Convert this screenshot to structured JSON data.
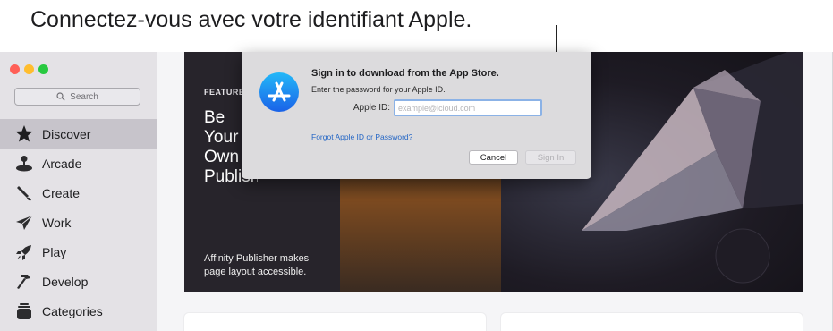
{
  "caption": "Connectez-vous avec votre identifiant Apple.",
  "sidebar": {
    "search_placeholder": "Search",
    "items": [
      {
        "label": "Discover",
        "icon": "star-icon",
        "active": true
      },
      {
        "label": "Arcade",
        "icon": "joystick-icon",
        "active": false
      },
      {
        "label": "Create",
        "icon": "brush-icon",
        "active": false
      },
      {
        "label": "Work",
        "icon": "paper-plane-icon",
        "active": false
      },
      {
        "label": "Play",
        "icon": "rocket-icon",
        "active": false
      },
      {
        "label": "Develop",
        "icon": "hammer-icon",
        "active": false
      },
      {
        "label": "Categories",
        "icon": "stack-icon",
        "active": false
      }
    ]
  },
  "hero": {
    "eyebrow": "FEATURED",
    "title": "Be Your Own Publisher",
    "description": "Affinity Publisher makes page layout accessible."
  },
  "dialog": {
    "title": "Sign in to download from the App Store.",
    "subtitle": "Enter the password for your Apple ID.",
    "apple_id_label": "Apple ID:",
    "apple_id_placeholder": "example@icloud.com",
    "forgot_link": "Forgot Apple ID or Password?",
    "cancel_label": "Cancel",
    "signin_label": "Sign In"
  },
  "colors": {
    "accent": "#1a82fb",
    "link": "#2466c5",
    "traffic_red": "#ff5f57",
    "traffic_yellow": "#ffbd2e",
    "traffic_green": "#28c940"
  }
}
